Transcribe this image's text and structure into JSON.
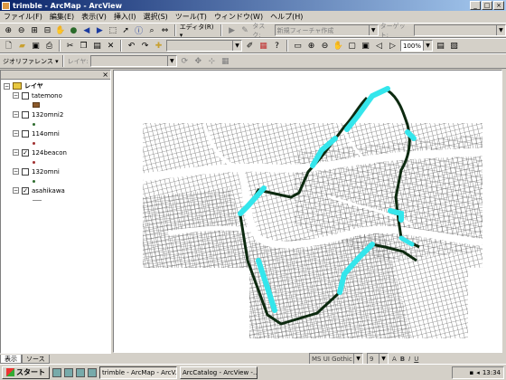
{
  "window": {
    "title": "trimble - ArcMap - ArcView",
    "buttons": [
      "_",
      "□",
      "×"
    ]
  },
  "menubar": [
    "ファイル(F)",
    "編集(E)",
    "表示(V)",
    "挿入(I)",
    "選択(S)",
    "ツール(T)",
    "ウィンドウ(W)",
    "ヘルプ(H)"
  ],
  "toolbar1": {
    "scale_value": "",
    "editor_label": "エディタ(R) ▾",
    "task_label": "タスク:",
    "task_value": "新規フィーチャ作成",
    "target_label": "ターゲット:",
    "target_value": ""
  },
  "toolbar2": {
    "combo_value": "",
    "zoom_value": "100%"
  },
  "toolbar3": {
    "georef_label": "ジオリファレンス ▾",
    "layer_label": "レイヤ:",
    "layer_value": ""
  },
  "toc": {
    "root": "レイヤ",
    "layers": [
      {
        "name": "tatemono",
        "checked": false,
        "legend": "swatch"
      },
      {
        "name": "132omni2",
        "checked": false,
        "legend": "dot-green"
      },
      {
        "name": "114omni",
        "checked": false,
        "legend": "dot-red"
      },
      {
        "name": "124beacon",
        "checked": true,
        "legend": "dot-green"
      },
      {
        "name": "132omni",
        "checked": false,
        "legend": "dot-green"
      },
      {
        "name": "asahikawa",
        "checked": true,
        "legend": "line"
      }
    ],
    "tabs": [
      "表示",
      "ソース"
    ]
  },
  "drawbar": {
    "font": "MS UI Gothic",
    "size": "9",
    "tools": [
      "A",
      "B",
      "I",
      "U"
    ]
  },
  "taskbar": {
    "start": "スタート",
    "tasks": [
      "trimble - ArcMap - ArcV...",
      "ArcCatalog - ArcView -..."
    ],
    "clock": "13:34"
  },
  "colors": {
    "route_cyan": "#34e6ec",
    "route_dark": "#0d2a10",
    "street": "#3a3a3a",
    "river": "#ffffff"
  }
}
